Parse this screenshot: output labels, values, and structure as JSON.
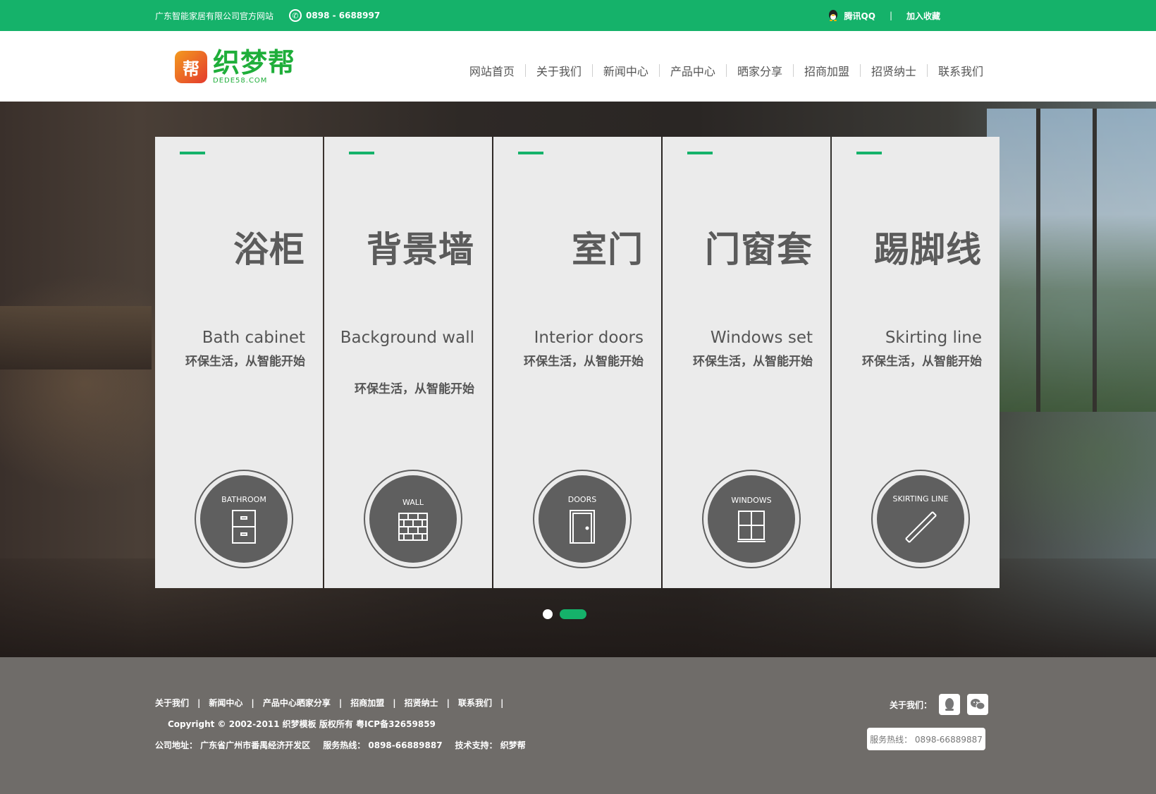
{
  "topbar": {
    "company": "广东智能家居有限公司官方网站",
    "phone": "0898 - 6688997",
    "qq_label": "腾讯QQ",
    "separator": "|",
    "favorite_label": "加入收藏"
  },
  "logo": {
    "mark": "帮",
    "main": "织梦帮",
    "sub": "DEDE58.COM"
  },
  "nav": {
    "items": [
      {
        "label": "网站首页"
      },
      {
        "label": "关于我们"
      },
      {
        "label": "新闻中心"
      },
      {
        "label": "产品中心"
      },
      {
        "label": "晒家分享"
      },
      {
        "label": "招商加盟"
      },
      {
        "label": "招贤纳士"
      },
      {
        "label": "联系我们"
      }
    ]
  },
  "cards": [
    {
      "title": "浴柜",
      "en": "Bath cabinet",
      "slogan": "环保生活，从智能开始",
      "badge": "BATHROOM",
      "icon": "cabinet-icon"
    },
    {
      "title": "背景墙",
      "en": "Background wall",
      "slogan": "环保生活，从智能开始",
      "badge": "WALL",
      "icon": "brick-wall-icon"
    },
    {
      "title": "室门",
      "en": "Interior doors",
      "slogan": "环保生活，从智能开始",
      "badge": "DOORS",
      "icon": "door-icon"
    },
    {
      "title": "门窗套",
      "en": "Windows set",
      "slogan": "环保生活，从智能开始",
      "badge": "WINDOWS",
      "icon": "window-icon"
    },
    {
      "title": "踢脚线",
      "en": "Skirting line",
      "slogan": "环保生活，从智能开始",
      "badge": "SKIRTING LINE",
      "icon": "skirting-line-icon"
    }
  ],
  "carousel": {
    "count": 2,
    "active_index": 1
  },
  "footer": {
    "links": [
      {
        "label": "关于我们"
      },
      {
        "label": "新闻中心"
      },
      {
        "label": "产品中心晒家分享"
      },
      {
        "label": "招商加盟"
      },
      {
        "label": "招贤纳士"
      },
      {
        "label": "联系我们"
      }
    ],
    "separator": "|",
    "copyright": "Copyright © 2002-2011 织梦模板 版权所有  粤ICP备32659859",
    "address": "公司地址：  广东省广州市番禺经济开发区",
    "hotline_text": "服务热线：  0898-66889887",
    "support": "技术支持：  织梦帮",
    "about_label": "关于我们：",
    "hotline_box": "服务热线：  0898-66889887"
  },
  "colors": {
    "brand_green": "#15b26a",
    "card_bg": "#ebebeb",
    "badge_gray": "#5f5f5f",
    "footer_bg": "#6f6c69"
  }
}
